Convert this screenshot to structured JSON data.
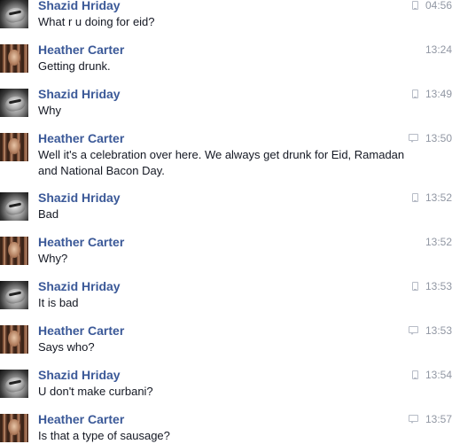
{
  "messages": [
    {
      "sender": "Shazid Hriday",
      "avatar": "shazid",
      "text": "What r u doing for eid?",
      "time": "04:56",
      "source_icon": "phone-icon"
    },
    {
      "sender": "Heather Carter",
      "avatar": "heather",
      "text": "Getting drunk.",
      "time": "13:24",
      "source_icon": "none"
    },
    {
      "sender": "Shazid Hriday",
      "avatar": "shazid",
      "text": "Why",
      "time": "13:49",
      "source_icon": "phone-icon"
    },
    {
      "sender": "Heather Carter",
      "avatar": "heather",
      "text": "Well it's a celebration over here. We always get drunk for Eid, Ramadan and National Bacon Day.",
      "time": "13:50",
      "source_icon": "chat-icon"
    },
    {
      "sender": "Shazid Hriday",
      "avatar": "shazid",
      "text": "Bad",
      "time": "13:52",
      "source_icon": "phone-icon"
    },
    {
      "sender": "Heather Carter",
      "avatar": "heather",
      "text": "Why?",
      "time": "13:52",
      "source_icon": "none"
    },
    {
      "sender": "Shazid Hriday",
      "avatar": "shazid",
      "text": "It is bad",
      "time": "13:53",
      "source_icon": "phone-icon"
    },
    {
      "sender": "Heather Carter",
      "avatar": "heather",
      "text": "Says who?",
      "time": "13:53",
      "source_icon": "chat-icon"
    },
    {
      "sender": "Shazid Hriday",
      "avatar": "shazid",
      "text": "U don't make curbani?",
      "time": "13:54",
      "source_icon": "phone-icon"
    },
    {
      "sender": "Heather Carter",
      "avatar": "heather",
      "text": "Is that a type of sausage?",
      "time": "13:57",
      "source_icon": "chat-icon"
    }
  ]
}
